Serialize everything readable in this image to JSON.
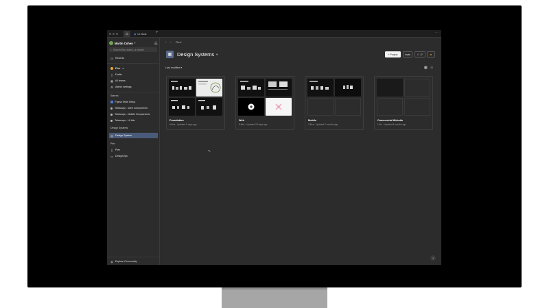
{
  "titlebar": {
    "file_tab": "UI kinds"
  },
  "sidebar": {
    "user_name": "Martin Cohen",
    "search_placeholder": "Search files, teams, or people",
    "recents": "Recents",
    "team": "Plex",
    "team_items": [
      "Drafts",
      "All teams",
      "Admin settings"
    ],
    "starred_label": "Starred",
    "starred": [
      "Figma Teals Setup",
      "Telescope - Web Components",
      "Telescope - Mobile Components",
      "Telescope - UI kits"
    ],
    "design_systems_label": "Design Systems",
    "design_systems_item": "Design System",
    "plex_label": "Plex",
    "plex_items": [
      "Plex",
      "DesignOps"
    ],
    "explore": "Explore Community"
  },
  "main": {
    "breadcrumb": "Plexi",
    "title": "Design Systems",
    "buttons": {
      "project": "+ Project",
      "invite": "Invite",
      "share": "17"
    },
    "sort": "Last modified",
    "cards": [
      {
        "name": "Foundation",
        "meta": "6 files · Updated 9 days ago"
      },
      {
        "name": "Web",
        "meta": "5 files · Updated 23 days ago"
      },
      {
        "name": "Mobile",
        "meta": "2 files · Updated 3 months ago"
      },
      {
        "name": "Commercial Website",
        "meta": "1 file · Updated 6 months ago"
      }
    ]
  },
  "help": "?",
  "colors": {
    "accent": "#4a5a7a",
    "star": "#f5c242",
    "plan": "#f5a623",
    "avatar": "#6fa34e"
  }
}
